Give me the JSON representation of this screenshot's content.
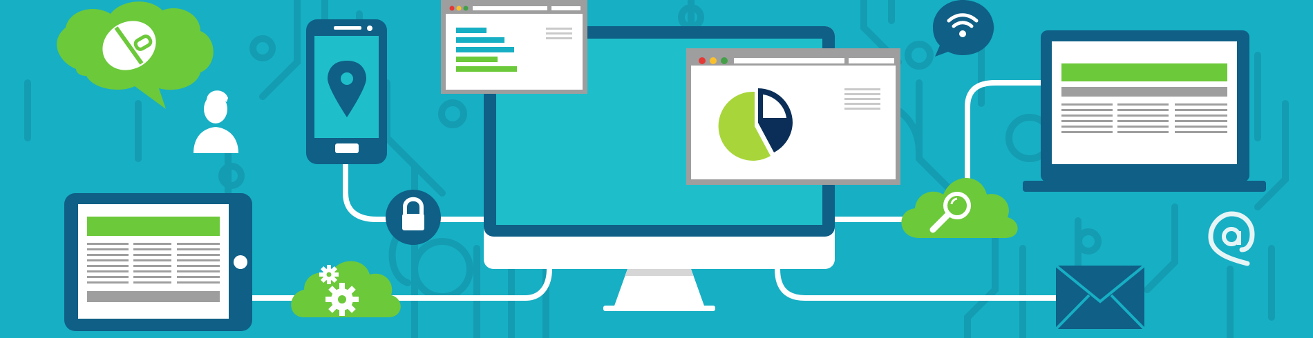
{
  "scene": {
    "description_free": true,
    "colors": {
      "background": "#17AFC4",
      "circuit": "#1496AD",
      "dark_blue": "#0F5F86",
      "navy": "#0A2E57",
      "screen_teal": "#1EBFCB",
      "green": "#6CC93A",
      "light_green": "#A8D63A",
      "white": "#FFFFFF",
      "grey": "#9E9E9E",
      "light_grey": "#C9C9C9",
      "red_dot": "#E53935",
      "yellow_dot": "#F9C02E",
      "green_dot": "#43A047"
    },
    "icons": [
      "cloud-mouse-icon",
      "user-icon",
      "smartphone-icon",
      "location-pin-icon",
      "lock-icon",
      "cloud-gears-icon",
      "wifi-icon",
      "cloud-search-icon",
      "at-sign-icon",
      "envelope-icon"
    ],
    "devices": [
      "tablet",
      "smartphone",
      "desktop-monitor",
      "laptop"
    ],
    "windows": [
      "bar-chart-window",
      "pie-chart-window"
    ]
  }
}
